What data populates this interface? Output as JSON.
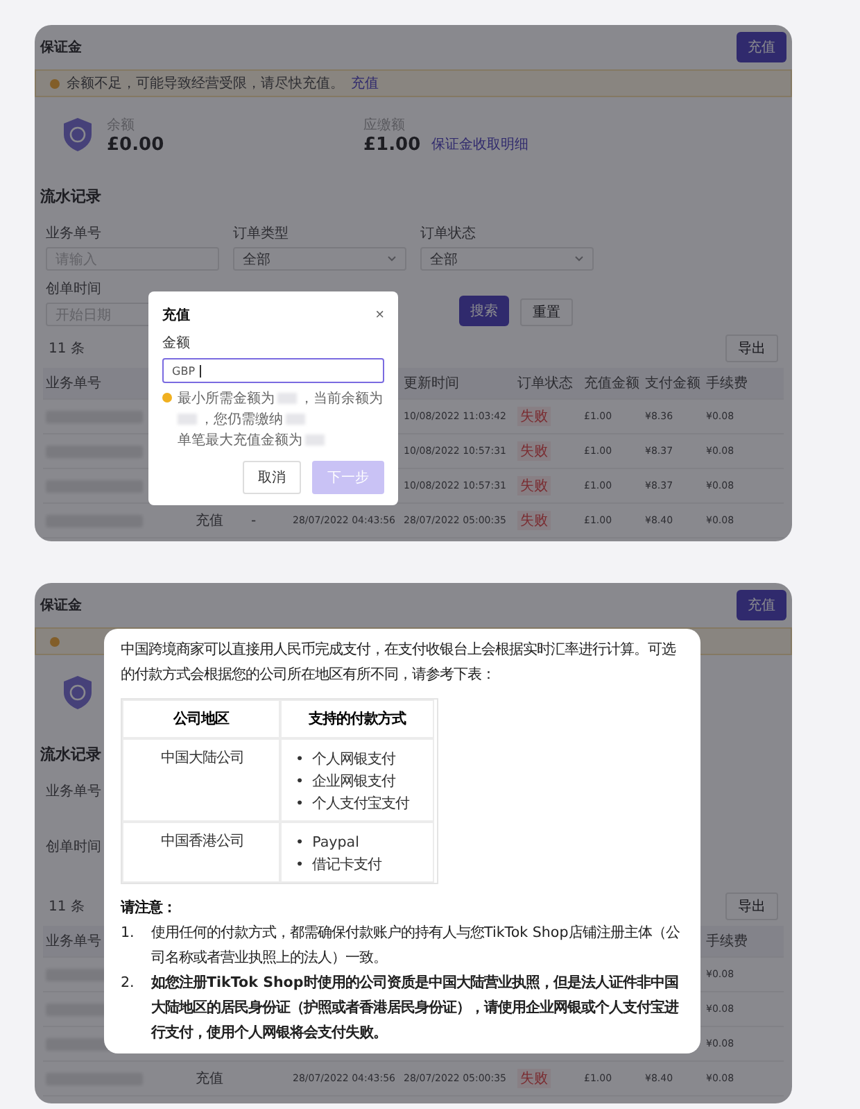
{
  "screens": [
    {
      "kind": "recharge_dialog",
      "dashboard": {
        "title": "保证金",
        "recharge_button": "充值",
        "warning": {
          "text": "余额不足，可能导致经营受限，请尽快充值。",
          "link": "充值"
        },
        "stats": [
          {
            "label": "余额",
            "amount": "£0.00"
          },
          {
            "label": "应缴额",
            "amount": "£1.00",
            "link": "保证金收取明细"
          }
        ],
        "section_title": "流水记录",
        "filter_rows": [
          [
            {
              "label": "业务单号",
              "placeholder": "请输入"
            },
            {
              "label": "订单类型",
              "value": "全部",
              "dropdown": true
            },
            {
              "label": "订单状态",
              "value": "全部",
              "dropdown": true
            }
          ],
          [
            {
              "label": "创单时间",
              "placeholder": "开始日期"
            }
          ]
        ],
        "search_button": "搜索",
        "reset_button": "重置",
        "count": "11 条",
        "export_button": "导出",
        "header": {
          "order_no": "业务单号",
          "updated": "更新时间",
          "status": "订单状态",
          "amount": "充值金额",
          "paid": "支付金额",
          "fee": "手续费"
        },
        "rows": [
          {
            "updated": "10/08/2022 11:03:42",
            "status": "失败",
            "amount": "£1.00",
            "paid": "¥8.36",
            "fee": "¥0.08"
          },
          {
            "updated": "10/08/2022 10:57:31",
            "status": "失败",
            "amount": "£1.00",
            "paid": "¥8.37",
            "fee": "¥0.08"
          },
          {
            "updated": "10/08/2022 10:57:31",
            "status": "失败",
            "amount": "£1.00",
            "paid": "¥8.37",
            "fee": "¥0.08"
          },
          {
            "type": "充值",
            "note": "-",
            "created": "28/07/2022 04:43:56",
            "updated": "28/07/2022 05:00:35",
            "status": "失败",
            "amount": "£1.00",
            "paid": "¥8.40",
            "fee": "¥0.08"
          }
        ]
      },
      "dialog": {
        "title": "充值",
        "close": "×",
        "label": "金额",
        "prefix": "GBP",
        "hint_parts": [
          "最小所需金额为",
          "，当前余额为",
          "，您仍需缴纳",
          "单笔最大充值金额为"
        ],
        "buttons": [
          {
            "label": "取消",
            "primary": false,
            "disabled": false
          },
          {
            "label": "下一步",
            "primary": true,
            "disabled": true
          }
        ]
      }
    },
    {
      "kind": "payment_info",
      "dashboard": {
        "title": "保证金",
        "recharge_button": "充值",
        "section_title": "流水记录",
        "filter_rows": [
          [
            {
              "label": "业务单号"
            }
          ],
          [
            {
              "label": "创单时间"
            }
          ]
        ],
        "count": "11 条",
        "export_button": "导出",
        "header": {
          "order_no": "业务单号",
          "fee": "手续费"
        },
        "rows": [
          {
            "fee": "¥0.08"
          },
          {
            "fee": "¥0.08"
          },
          {
            "fee": "¥0.08"
          },
          {
            "type": "充值",
            "created": "28/07/2022 04:43:56",
            "updated": "28/07/2022 05:00:35",
            "status": "失败",
            "amount": "£1.00",
            "paid": "¥8.40",
            "fee": "¥0.08"
          }
        ]
      },
      "dialog": {
        "intro": "中国跨境商家可以直接用人民币完成支付，在支付收银台上会根据实时汇率进行计算。可选的付款方式会根据您的公司所在地区有所不同，请参考下表：",
        "table": {
          "columns": [
            "公司地区",
            "支持的付款方式"
          ],
          "rows": [
            {
              "region": "中国大陆公司",
              "methods": [
                {
                  "bullet": "•",
                  "text": "个人网银支付"
                },
                {
                  "bullet": "•",
                  "text": "企业网银支付"
                },
                {
                  "bullet": "•",
                  "text": "个人支付宝支付"
                }
              ]
            },
            {
              "region": "中国香港公司",
              "methods": [
                {
                  "bullet": "•",
                  "text": "Paypal"
                },
                {
                  "bullet": "•",
                  "text": "借记卡支付"
                }
              ]
            }
          ]
        },
        "notes_title": "请注意：",
        "notes": [
          {
            "marker": "1.",
            "text": "使用任何的付款方式，都需确保付款账户的持有人与您TikTok Shop店铺注册主体（公司名称或者营业执照上的法人）一致。",
            "bold": false
          },
          {
            "marker": "2.",
            "text": "如您注册TikTok Shop时使用的公司资质是中国大陆营业执照，但是法人证件非中国大陆地区的居民身份证（护照或者香港居民身份证），请使用企业网银或个人支付宝进行支付，使用个人网银将会支付失败。",
            "bold": true
          }
        ]
      }
    }
  ]
}
